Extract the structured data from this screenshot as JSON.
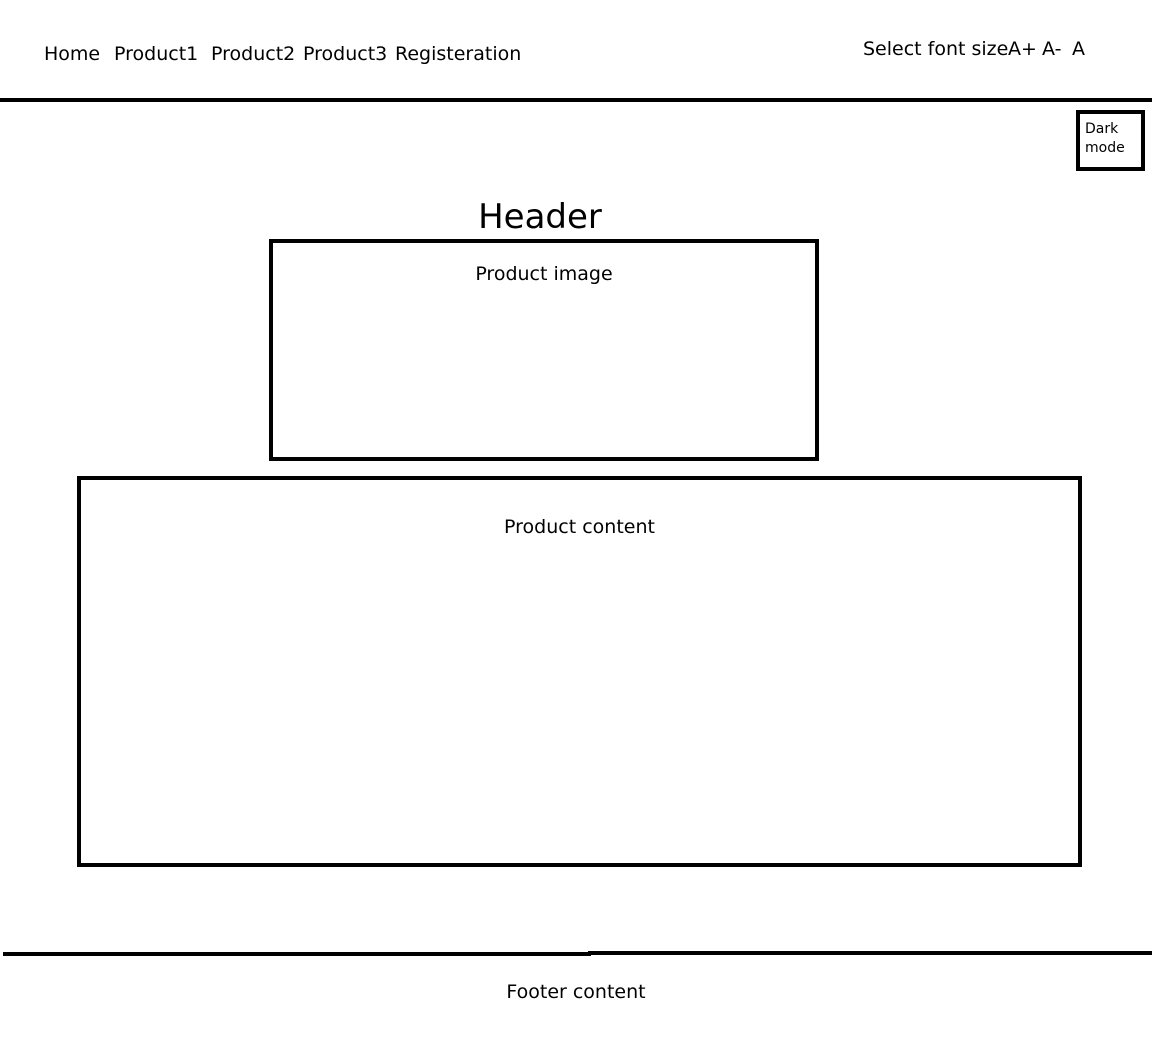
{
  "nav": {
    "items": [
      {
        "label": "Home"
      },
      {
        "label": "Product1"
      },
      {
        "label": "Product2"
      },
      {
        "label": "Product3"
      },
      {
        "label": "Registeration"
      }
    ]
  },
  "font_size": {
    "label": "Select font size",
    "increase": "A+",
    "decrease": "A-",
    "reset": "A"
  },
  "dark_mode": {
    "line1": "Dark",
    "line2": "mode"
  },
  "header": {
    "title": "Header"
  },
  "product_image": {
    "label": "Product image"
  },
  "product_content": {
    "label": "Product content"
  },
  "footer": {
    "text": "Footer content"
  }
}
